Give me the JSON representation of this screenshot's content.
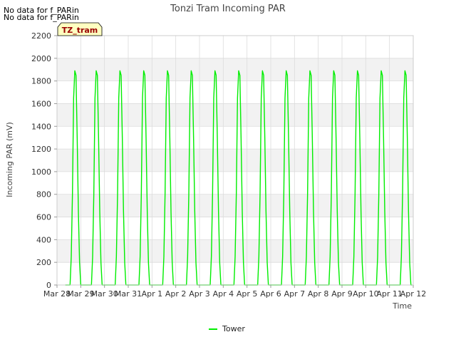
{
  "notes": [
    "No data for f_PARin",
    "No data for f_PARin"
  ],
  "chart_data": {
    "type": "line",
    "title": "Tonzi Tram Incoming PAR",
    "xlabel": "Time",
    "ylabel": "Incoming PAR (mV)",
    "ylim": [
      0,
      2200
    ],
    "yticks": [
      0,
      200,
      400,
      600,
      800,
      1000,
      1200,
      1400,
      1600,
      1800,
      2000,
      2200
    ],
    "xlim": [
      0,
      15
    ],
    "xticks": [
      0,
      1,
      2,
      3,
      4,
      5,
      6,
      7,
      8,
      9,
      10,
      11,
      12,
      13,
      14,
      15
    ],
    "xticklabels": [
      "Mar 28",
      "Mar 29",
      "Mar 30",
      "Mar 31",
      "Apr 1",
      "Apr 2",
      "Apr 3",
      "Apr 4",
      "Apr 5",
      "Apr 6",
      "Apr 7",
      "Apr 8",
      "Apr 9",
      "Apr 10",
      "Apr 11",
      "Apr 12"
    ],
    "grid": true,
    "legend_box_label": "TZ_tram",
    "series": [
      {
        "name": "Tower",
        "color": "#00ee00",
        "x": [
          0.35,
          0.55,
          0.6,
          0.65,
          0.7,
          0.75,
          0.8,
          0.85,
          0.9,
          0.95,
          1.0,
          1.05,
          1.1,
          1.15,
          1.2,
          1.25,
          1.3,
          1.35,
          1.4,
          1.45,
          1.5,
          1.55,
          1.6,
          1.65,
          1.7,
          1.75,
          1.8,
          1.85,
          1.9,
          1.95,
          2.0,
          2.05,
          2.1,
          2.15,
          2.2,
          2.25,
          2.3,
          2.35,
          2.4,
          2.45,
          2.5,
          2.55,
          2.6,
          2.65,
          2.7,
          2.75,
          2.8,
          2.85,
          2.9,
          2.95,
          3.0,
          3.05,
          3.1,
          3.15,
          3.2,
          3.25,
          3.3,
          3.35,
          3.4,
          3.45,
          3.5,
          3.55,
          3.6,
          3.65,
          3.7,
          3.75,
          3.8,
          3.85,
          3.9,
          3.95,
          4.0,
          4.05,
          4.1,
          4.15,
          4.2,
          4.25,
          4.3,
          4.35,
          4.4,
          4.45,
          4.5,
          4.55,
          4.6,
          4.65,
          4.7,
          4.75,
          4.8,
          4.85,
          4.9,
          4.95,
          5.0,
          5.05,
          5.1,
          5.15,
          5.2,
          5.25,
          5.3,
          5.35,
          5.4,
          5.45,
          5.5,
          5.55,
          5.6,
          5.65,
          5.7,
          5.75,
          5.8,
          5.85,
          5.9,
          5.95,
          6.0,
          6.05,
          6.1,
          6.15,
          6.2,
          6.25,
          6.3,
          6.35,
          6.4,
          6.45,
          6.5,
          6.55,
          6.6,
          6.65,
          6.7,
          6.75,
          6.8,
          6.85,
          6.9,
          6.95,
          7.0,
          7.05,
          7.1,
          7.15,
          7.2,
          7.25,
          7.3,
          7.35,
          7.4,
          7.45,
          7.5,
          7.55,
          7.6,
          7.65,
          7.7,
          7.75,
          7.8,
          7.85,
          7.9,
          7.95,
          8.0,
          8.05,
          8.1,
          8.15,
          8.2,
          8.25,
          8.3,
          8.35,
          8.4,
          8.45,
          8.5,
          8.55,
          8.6,
          8.65,
          8.7,
          8.75,
          8.8,
          8.85,
          8.9,
          8.95,
          9.0,
          9.05,
          9.1,
          9.15,
          9.2,
          9.25,
          9.3,
          9.35,
          9.4,
          9.45,
          9.5,
          9.55,
          9.6,
          9.65,
          9.7,
          9.75,
          9.8,
          9.85,
          9.9,
          9.95,
          10.0,
          10.05,
          10.1,
          10.15,
          10.2,
          10.25,
          10.3,
          10.35,
          10.4,
          10.45,
          10.5,
          10.55,
          10.6,
          10.65,
          10.7,
          10.75,
          10.8,
          10.85,
          10.9,
          10.95,
          11.0,
          11.05,
          11.1,
          11.15,
          11.2,
          11.25,
          11.3,
          11.35,
          11.4,
          11.45,
          11.5,
          11.55,
          11.6,
          11.65,
          11.7,
          11.75,
          11.8,
          11.85,
          11.9,
          11.95,
          12.0,
          12.05,
          12.1,
          12.15,
          12.2,
          12.25,
          12.3,
          12.35,
          12.4,
          12.45,
          12.5,
          12.55,
          12.6,
          12.65,
          12.7,
          12.75,
          12.8,
          12.85,
          12.9,
          12.95,
          13.0,
          13.05,
          13.1,
          13.15,
          13.2,
          13.25,
          13.3,
          13.35,
          13.4,
          13.45,
          13.5,
          13.55,
          13.6,
          13.65,
          13.7,
          13.75,
          13.8,
          13.85,
          13.9,
          13.95,
          14.0,
          14.05,
          14.1,
          14.15,
          14.2,
          14.25,
          14.3,
          14.35,
          14.4,
          14.45,
          14.5,
          14.55,
          14.6,
          14.65,
          14.7,
          14.75,
          14.8,
          14.85,
          14.9,
          14.95
        ],
        "y": [
          0,
          0,
          250,
          800,
          1650,
          1890,
          1850,
          1300,
          650,
          200,
          0,
          0,
          0,
          0,
          0,
          0,
          0,
          0,
          0,
          0,
          250,
          800,
          1650,
          1890,
          1850,
          1300,
          650,
          200,
          0,
          0,
          0,
          0,
          0,
          0,
          0,
          0,
          0,
          0,
          0,
          0,
          250,
          800,
          1650,
          1890,
          1850,
          1300,
          650,
          200,
          0,
          0,
          0,
          0,
          0,
          0,
          0,
          0,
          0,
          0,
          0,
          0,
          250,
          800,
          1650,
          1890,
          1850,
          1300,
          650,
          200,
          0,
          0,
          0,
          0,
          0,
          0,
          0,
          0,
          0,
          0,
          0,
          0,
          250,
          800,
          1650,
          1890,
          1850,
          1300,
          650,
          200,
          0,
          0,
          0,
          0,
          0,
          0,
          0,
          0,
          0,
          0,
          0,
          0,
          250,
          800,
          1650,
          1890,
          1850,
          1300,
          650,
          200,
          0,
          0,
          0,
          0,
          0,
          0,
          0,
          0,
          0,
          0,
          0,
          0,
          250,
          800,
          1650,
          1890,
          1850,
          1300,
          650,
          200,
          0,
          0,
          0,
          0,
          0,
          0,
          0,
          0,
          0,
          0,
          0,
          0,
          250,
          800,
          1650,
          1890,
          1850,
          1300,
          650,
          200,
          0,
          0,
          0,
          0,
          0,
          0,
          0,
          0,
          0,
          0,
          0,
          0,
          250,
          800,
          1650,
          1890,
          1850,
          1300,
          650,
          200,
          0,
          0,
          0,
          0,
          0,
          0,
          0,
          0,
          0,
          0,
          0,
          0,
          250,
          800,
          1650,
          1890,
          1850,
          1300,
          650,
          200,
          0,
          0,
          0,
          0,
          0,
          0,
          0,
          0,
          0,
          0,
          0,
          0,
          250,
          800,
          1650,
          1890,
          1850,
          1300,
          650,
          200,
          0,
          0,
          0,
          0,
          0,
          0,
          0,
          0,
          0,
          0,
          0,
          0,
          250,
          800,
          1650,
          1890,
          1850,
          1300,
          650,
          200,
          0,
          0,
          0,
          0,
          0,
          0,
          0,
          0,
          0,
          0,
          0,
          0,
          250,
          800,
          1650,
          1890,
          1850,
          1300,
          650,
          200,
          0,
          0,
          0,
          0,
          0,
          0,
          0,
          0,
          0,
          0,
          0,
          0,
          250,
          800,
          1650,
          1890,
          1850,
          1300,
          650,
          200,
          0,
          0,
          0,
          0,
          0,
          0,
          0,
          0,
          0,
          0,
          0,
          0,
          250,
          800,
          1650,
          1890,
          1850,
          1300,
          650,
          200,
          0,
          0
        ]
      }
    ]
  }
}
